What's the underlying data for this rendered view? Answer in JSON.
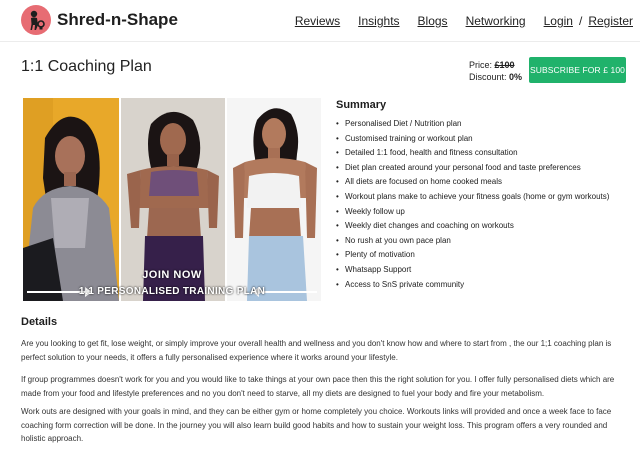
{
  "header": {
    "brand": "Shred-n-Shape",
    "nav": [
      "Reviews",
      "Insights",
      "Blogs",
      "Networking"
    ],
    "login": "Login",
    "separator": "/",
    "register": "Register"
  },
  "plan": {
    "title": "1:1 Coaching Plan",
    "price_label": "Price:",
    "price_old": "£100",
    "discount_label": "Discount:",
    "discount_value": "0%",
    "subscribe_label": "SUBSCRIBE FOR £ 100"
  },
  "collage": {
    "join_text": "JOIN NOW",
    "plan_text": "1:1 PERSONALISED TRAINING PLAN"
  },
  "summary": {
    "title": "Summary",
    "items": [
      "Personalised Diet / Nutrition plan",
      "Customised training or workout plan",
      "Detailed 1:1 food, health and fitness consultation",
      "Diet plan created around your personal food and taste preferences",
      "All diets are focused on home cooked meals",
      "Workout plans make to achieve your fitness goals (home or gym workouts)",
      "Weekly follow up",
      "Weekly diet changes and coaching on workouts",
      "No rush at you own pace plan",
      "Plenty of motivation",
      "Whatsapp Support",
      "Access to SnS private community"
    ]
  },
  "details": {
    "title": "Details",
    "paragraphs": [
      "Are you looking to get fit, lose weight, or simply improve your overall health and wellness and you don't know how and where to start from , the our 1;1 coaching plan is perfect solution to your needs, it offers a fully personalised experience where it works around your lifestyle.",
      "If group programmes doesn't work for you and you would like to take things at your own pace then this the right solution for you. I offer fully personalised diets which are made from your food and lifestyle preferences and no you don't need to starve, all my diets are designed to fuel your body and fire your metabolism.",
      "Work outs are designed with your goals in mind, and they can be either gym or home completely you choice. Workouts links will provided and once a week face to face coaching form correction will be done. In the journey you will also learn build good habits and how to sustain your weight loss. This program offers a very rounded and holistic approach."
    ]
  },
  "colors": {
    "accent": "#20b26b",
    "logo": "#e76c73"
  },
  "icons": {
    "logo": "kettlebell-person-icon"
  }
}
